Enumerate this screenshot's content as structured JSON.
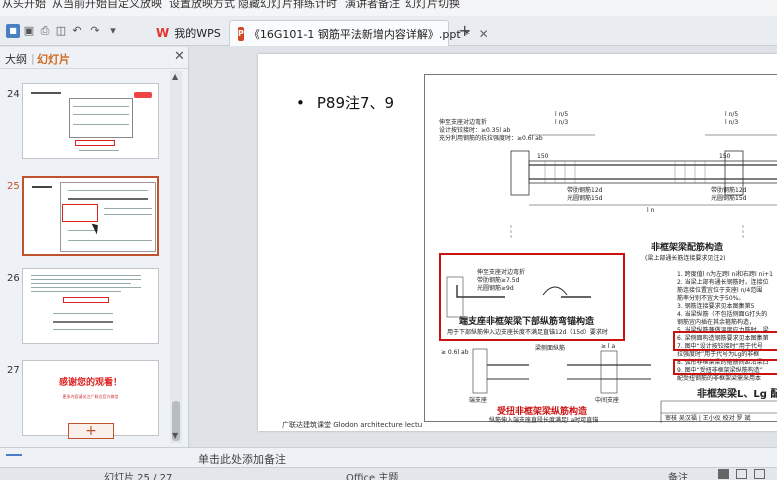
{
  "ribbon": {
    "tabs": [
      "从头开始",
      "从当前开始",
      "自定义放映",
      "设置放映方式",
      "隐藏幻灯片",
      "排练计时",
      "演讲者备注",
      "幻灯片切换"
    ]
  },
  "tabs": {
    "wps_label": "我的WPS",
    "doc_label": "《16G101-1 钢筋平法新增内容详解》.ppt *"
  },
  "left_pane": {
    "outline_tab": "大纲",
    "slides_tab": "幻灯片",
    "slides": [
      {
        "number": "24",
        "selected": false
      },
      {
        "number": "25",
        "selected": true
      },
      {
        "number": "26",
        "selected": false
      },
      {
        "number": "27",
        "selected": false,
        "title": "感谢您的观看！",
        "subtitle": "更多内容请关注广联达官方微信"
      }
    ]
  },
  "slide": {
    "bullet": "P89注7、9",
    "footer": "广联达建筑课堂    Glodon  architecture  lectu",
    "drawing": {
      "section_title": "非框架梁配筋构造",
      "section_subtitle": "(梁上部通长筋连接要求见注2)",
      "red_box_title": "端支座非框架梁下部纵筋弯锚构造",
      "red_box_note": "用于下部纵筋伸入边支座长度不满足直锚12d（15d）要求时",
      "bottom_title": "受扭非框架梁纵筋构造",
      "bottom_note": "纵筋伸入端支座直段长度满足l a时可直锚",
      "right_title": "非框架梁L、Lg 配",
      "label_pin": "伸至支座对边弯折",
      "label_design": "设计按铰接时：≥0.35l ab",
      "label_full": "充分利用钢筋的抗拉强度时：≥0.6l ab",
      "label_bend": "伸至支座对边弯折",
      "label_ribbed": "带肋钢筋≥7.5d",
      "label_plain": "光圆钢筋≥9d",
      "label_ribbed_12d": "带肋钢筋12d",
      "label_plain_15d": "光圆钢筋15d",
      "label_ln1_5": "l n/5",
      "label_ln1_3": "l n/3",
      "label_ln": "l n",
      "label_150": "150",
      "label_end_support": "端支座",
      "label_mid_support": "中间支座",
      "label_la": "≥ l a",
      "label_06lab": "≥ 0.6l ab",
      "label_rebar": "梁侧面纵筋",
      "notes_right": [
        "1. 跨度值l n为左跨l ni和右跨l ni+1",
        "2. 当梁上部有通长钢筋时，连接位",
        "   筋连接位置宜位于支座l n/4范围",
        "   筋率分别不宜大于50%。",
        "3. 钢筋连接要求见本图集第5",
        "4. 当梁纵筋（不包括侧面G打头的",
        "   钢筋宜内插在其余箍筋构造，",
        "5. 当梁纵筋兼做温度应力筋时，梁",
        "6. 梁侧面构造钢筋要求见本图集第",
        "7. 图中“设计按铰接时”用于代号",
        "   拉强度时”用于代号为Lg的非框",
        "8. 弧形非框架梁的箍筋间距沿梁凸",
        "9. 图中“受扭非框架梁纵筋构造”",
        "   配受扭钢筋的非框架梁需采用本"
      ],
      "table_row": "审核 吴汉福 | 王小仪 校对 罗 斌"
    }
  },
  "notes_placeholder": "单击此处添加备注",
  "status": {
    "slide_info": "幻灯片 25 / 27",
    "theme": "Office 主题",
    "notes_btn": "备注"
  }
}
